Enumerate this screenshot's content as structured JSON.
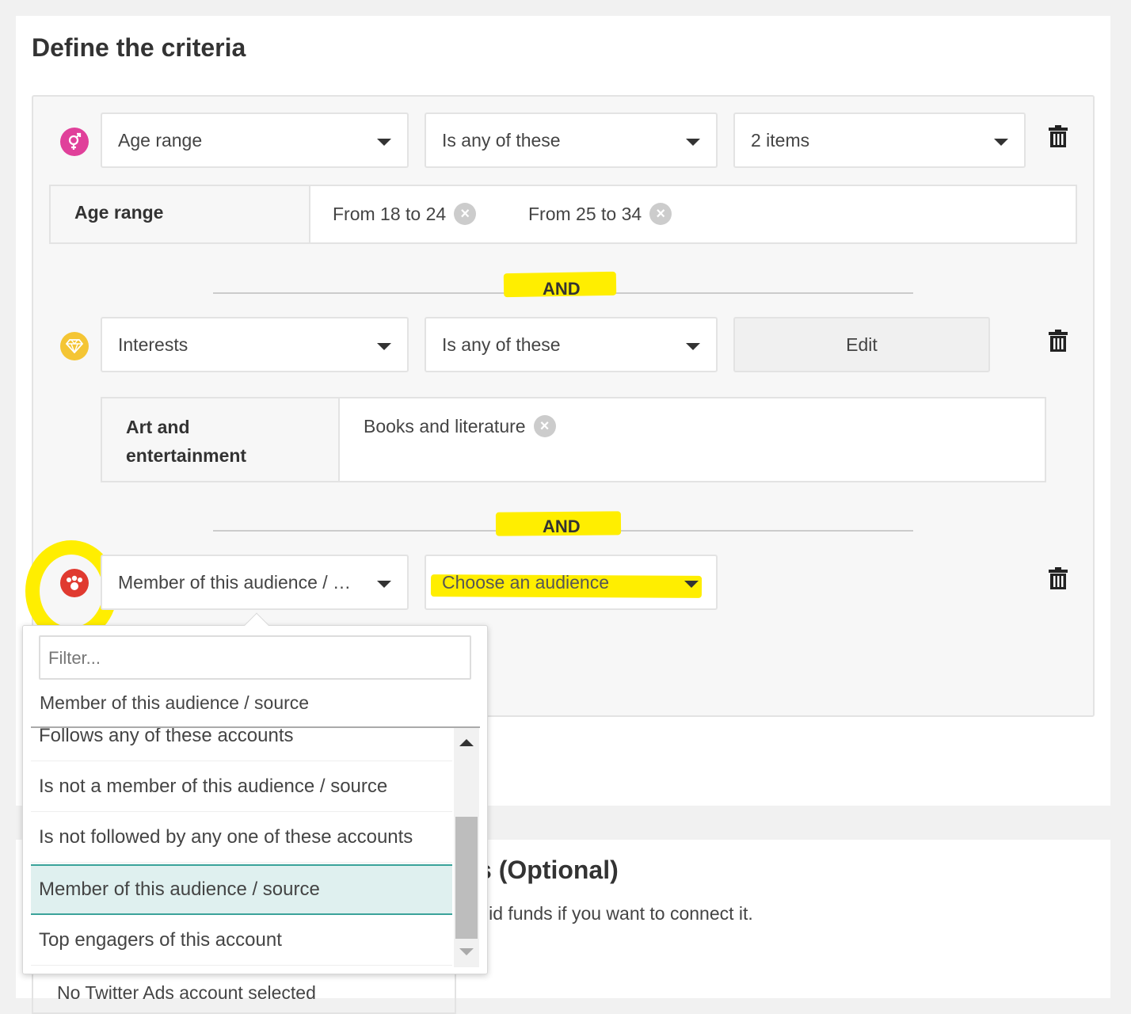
{
  "section1": {
    "title": "Define the criteria"
  },
  "rule1": {
    "icon": "gender-icon",
    "field": "Age range",
    "operator": "Is any of these",
    "value": "2 items",
    "group_label": "Age range",
    "tags": [
      "From 18 to 24",
      "From 25 to 34"
    ]
  },
  "and1": "AND",
  "rule2": {
    "icon": "diamond-icon",
    "field": "Interests",
    "operator": "Is any of these",
    "edit_label": "Edit",
    "group_label": "Art and entertainment",
    "tags": [
      "Books and literature"
    ]
  },
  "and2": "AND",
  "rule3": {
    "icon": "audience-icon",
    "field": "Member of this audience / …",
    "audience_placeholder": "Choose an audience"
  },
  "dropdown": {
    "filter_placeholder": "Filter...",
    "current": "Member of this audience / source",
    "options": [
      "Follows any of these accounts",
      "Is not a member of this audience / source",
      "Is not followed by any one of these accounts",
      "Member of this audience / source",
      "Top engagers of this account"
    ],
    "selected_index": 3
  },
  "section2": {
    "title_partial": "s (Optional)",
    "desc_partial": "lid funds if you want to connect it.",
    "select_partial": "No Twitter Ads account selected"
  },
  "colors": {
    "gender": "#e0409a",
    "diamond": "#f4c534",
    "audience": "#e03a30",
    "highlight": "#ffee00",
    "selected_option_bg": "#dff0ef",
    "selected_option_border": "#3aa39a"
  }
}
